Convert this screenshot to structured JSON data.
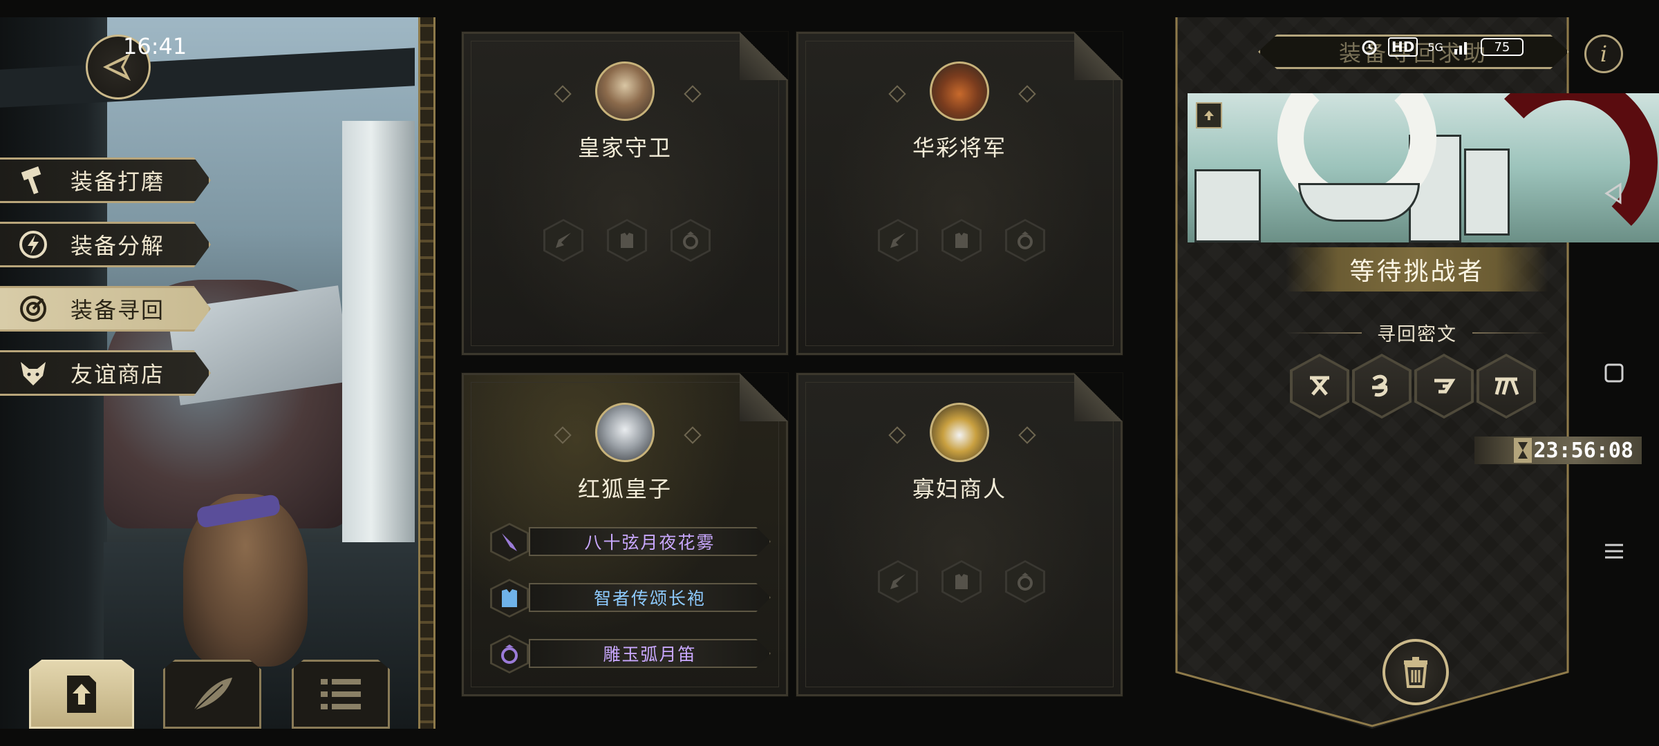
{
  "status_bar": {
    "time": "16:41",
    "hd_label": "HD",
    "network_label": "5G",
    "battery": "75"
  },
  "side_menu": {
    "items": [
      {
        "label": "装备打磨",
        "icon": "hammer-icon",
        "active": false
      },
      {
        "label": "装备分解",
        "icon": "lightning-circle-icon",
        "active": false
      },
      {
        "label": "装备寻回",
        "icon": "target-icon",
        "active": true
      },
      {
        "label": "友谊商店",
        "icon": "fox-head-icon",
        "active": false
      }
    ]
  },
  "cards": [
    {
      "name": "皇家守卫",
      "portrait": "royal-guard-portrait",
      "equipped": false
    },
    {
      "name": "华彩将军",
      "portrait": "splendid-general-portrait",
      "equipped": false
    },
    {
      "name": "红狐皇子",
      "portrait": "red-fox-prince-portrait",
      "equipped": true,
      "equipment": [
        {
          "label": "八十弦月夜花雾",
          "icon": "sword-icon",
          "color": "#c9a8ff"
        },
        {
          "label": "智者传颂长袍",
          "icon": "armor-icon",
          "color": "#8ecbff"
        },
        {
          "label": "雕玉弧月笛",
          "icon": "ring-icon",
          "color": "#c9a8ff"
        }
      ]
    },
    {
      "name": "寡妇商人",
      "portrait": "widow-merchant-portrait",
      "equipped": false
    }
  ],
  "right_panel": {
    "banner_title": "装备寻回求助",
    "status": "等待挑战者",
    "section_label": "寻回密文",
    "runes": [
      "rune-1-icon",
      "rune-2-icon",
      "rune-3-icon",
      "rune-4-icon"
    ],
    "timer": "23:56:08"
  },
  "colors": {
    "gold": "#cbb98a",
    "panel_dark": "#1c1b18",
    "purple_item": "#c9a8ff",
    "blue_item": "#8ecbff"
  }
}
